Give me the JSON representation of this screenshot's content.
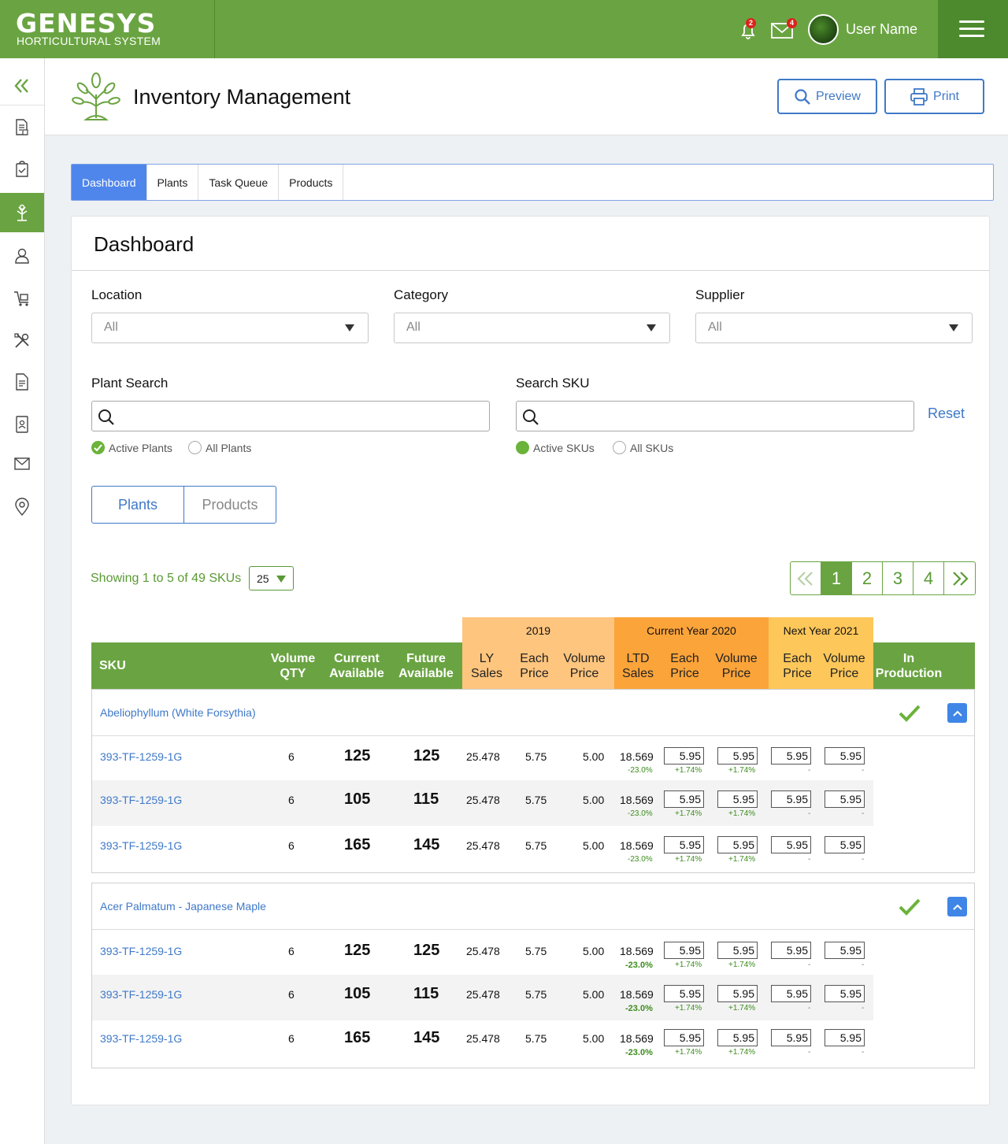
{
  "brand": {
    "name": "GENESYS",
    "subtitle": "HORTICULTURAL SYSTEM"
  },
  "topbar": {
    "notifications_count": "2",
    "messages_count": "4",
    "user_name": "User Name"
  },
  "page": {
    "title": "Inventory Management",
    "preview_label": "Preview",
    "print_label": "Print"
  },
  "tabs": [
    {
      "label": "Dashboard",
      "active": true
    },
    {
      "label": "Plants",
      "active": false
    },
    {
      "label": "Task Queue",
      "active": false
    },
    {
      "label": "Products",
      "active": false
    }
  ],
  "dashboard": {
    "title": "Dashboard",
    "filters": {
      "location": {
        "label": "Location",
        "value": "All"
      },
      "category": {
        "label": "Category",
        "value": "All"
      },
      "supplier": {
        "label": "Supplier",
        "value": "All"
      }
    },
    "plant_search": {
      "label": "Plant Search",
      "radio_active": "Active Plants",
      "radio_all": "All Plants"
    },
    "sku_search": {
      "label": "Search SKU",
      "radio_active": "Active SKUs",
      "radio_all": "All SKUs"
    },
    "reset_label": "Reset",
    "toggle": {
      "plants": "Plants",
      "products": "Products"
    },
    "showing": "Showing 1 to 5 of 49 SKUs",
    "per_page": "25",
    "pages": [
      "1",
      "2",
      "3",
      "4"
    ],
    "current_page": "1"
  },
  "table": {
    "group_headers": {
      "y2019": "2019",
      "current": "Current Year 2020",
      "next": "Next Year 2021"
    },
    "columns": {
      "sku": "SKU",
      "volume_qty": [
        "Volume",
        "QTY"
      ],
      "current_available": [
        "Current",
        "Available"
      ],
      "future_available": [
        "Future",
        "Available"
      ],
      "ly_sales": [
        "LY",
        "Sales"
      ],
      "each_price_2019": [
        "Each",
        "Price"
      ],
      "volume_price_2019": [
        "Volume",
        "Price"
      ],
      "ltd_sales": [
        "LTD",
        "Sales"
      ],
      "each_price_2020": [
        "Each",
        "Price"
      ],
      "volume_price_2020": [
        "Volume",
        "Price"
      ],
      "each_price_2021": [
        "Each",
        "Price"
      ],
      "volume_price_2021": [
        "Volume",
        "Price"
      ],
      "in_production": [
        "In",
        "Production"
      ]
    },
    "groups": [
      {
        "name": "Abeliophyllum (White Forsythia)",
        "rows": [
          {
            "sku": "393-TF-1259-1G",
            "vol_qty": "6",
            "current": "125",
            "future": "125",
            "ly_sales": "25.478",
            "each_2019": "5.75",
            "vol_2019": "5.00",
            "ltd_sales": "18.569",
            "ltd_change": "-23.0%",
            "each_2020": "5.95",
            "each_2020_change": "+1.74%",
            "vol_2020": "5.95",
            "vol_2020_change": "+1.74%",
            "each_2021": "5.95",
            "each_2021_change": "-",
            "vol_2021": "5.95",
            "vol_2021_change": "-"
          },
          {
            "sku": "393-TF-1259-1G",
            "vol_qty": "6",
            "current": "105",
            "future": "115",
            "ly_sales": "25.478",
            "each_2019": "5.75",
            "vol_2019": "5.00",
            "ltd_sales": "18.569",
            "ltd_change": "-23.0%",
            "each_2020": "5.95",
            "each_2020_change": "+1.74%",
            "vol_2020": "5.95",
            "vol_2020_change": "+1.74%",
            "each_2021": "5.95",
            "each_2021_change": "-",
            "vol_2021": "5.95",
            "vol_2021_change": "-"
          },
          {
            "sku": "393-TF-1259-1G",
            "vol_qty": "6",
            "current": "165",
            "future": "145",
            "ly_sales": "25.478",
            "each_2019": "5.75",
            "vol_2019": "5.00",
            "ltd_sales": "18.569",
            "ltd_change": "-23.0%",
            "each_2020": "5.95",
            "each_2020_change": "+1.74%",
            "vol_2020": "5.95",
            "vol_2020_change": "+1.74%",
            "each_2021": "5.95",
            "each_2021_change": "-",
            "vol_2021": "5.95",
            "vol_2021_change": "-"
          }
        ]
      },
      {
        "name": "Acer Palmatum - Japanese Maple",
        "rows": [
          {
            "sku": "393-TF-1259-1G",
            "vol_qty": "6",
            "current": "125",
            "future": "125",
            "ly_sales": "25.478",
            "each_2019": "5.75",
            "vol_2019": "5.00",
            "ltd_sales": "18.569",
            "ltd_change": "-23.0%",
            "each_2020": "5.95",
            "each_2020_change": "+1.74%",
            "vol_2020": "5.95",
            "vol_2020_change": "+1.74%",
            "each_2021": "5.95",
            "each_2021_change": "-",
            "vol_2021": "5.95",
            "vol_2021_change": "-"
          },
          {
            "sku": "393-TF-1259-1G",
            "vol_qty": "6",
            "current": "105",
            "future": "115",
            "ly_sales": "25.478",
            "each_2019": "5.75",
            "vol_2019": "5.00",
            "ltd_sales": "18.569",
            "ltd_change": "-23.0%",
            "each_2020": "5.95",
            "each_2020_change": "+1.74%",
            "vol_2020": "5.95",
            "vol_2020_change": "+1.74%",
            "each_2021": "5.95",
            "each_2021_change": "-",
            "vol_2021": "5.95",
            "vol_2021_change": "-"
          },
          {
            "sku": "393-TF-1259-1G",
            "vol_qty": "6",
            "current": "165",
            "future": "145",
            "ly_sales": "25.478",
            "each_2019": "5.75",
            "vol_2019": "5.00",
            "ltd_sales": "18.569",
            "ltd_change": "-23.0%",
            "each_2020": "5.95",
            "each_2020_change": "+1.74%",
            "vol_2020": "5.95",
            "vol_2020_change": "+1.74%",
            "each_2021": "5.95",
            "each_2021_change": "-",
            "vol_2021": "5.95",
            "vol_2021_change": "-"
          }
        ]
      }
    ]
  },
  "colors": {
    "brand_green": "#6aa442",
    "accent_blue": "#3f79c8",
    "year_2019": "#fec57e",
    "year_2020": "#fba43a",
    "year_2021": "#fdc75a"
  },
  "sidebar_icons": [
    "collapse-icon",
    "document-icon",
    "clipboard-check-icon",
    "plant-icon",
    "person-icon",
    "cart-icon",
    "tools-icon",
    "file-icon",
    "contact-book-icon",
    "mail-icon",
    "location-pin-icon"
  ]
}
